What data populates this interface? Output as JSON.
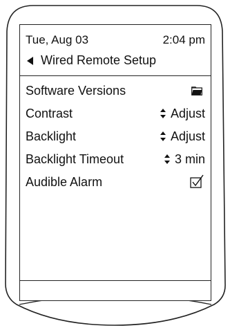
{
  "status": {
    "date": "Tue, Aug 03",
    "time": "2:04 pm"
  },
  "header": {
    "title": "Wired Remote Setup",
    "back_icon": "triangle-left-icon"
  },
  "menu": [
    {
      "label": "Software Versions",
      "icon": "folder-icon"
    },
    {
      "label": "Contrast",
      "value": "Adjust",
      "icon": "stepper-icon"
    },
    {
      "label": "Backlight",
      "value": "Adjust",
      "icon": "stepper-icon"
    },
    {
      "label": "Backlight Timeout",
      "value": "3 min",
      "icon": "stepper-icon"
    },
    {
      "label": "Audible Alarm",
      "checked": true,
      "icon": "checkbox-icon"
    }
  ]
}
